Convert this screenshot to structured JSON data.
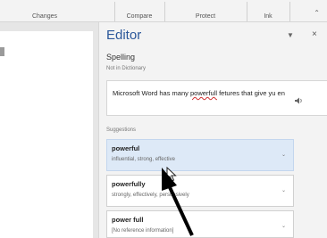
{
  "ribbon": {
    "groups": [
      {
        "label": "Changes"
      },
      {
        "label": "Compare"
      },
      {
        "label": "Protect"
      },
      {
        "label": "Ink"
      }
    ],
    "collapse_icon": "chevron-up-icon"
  },
  "editor": {
    "title": "Editor",
    "pin_icon": "chevron-down-icon",
    "close_icon": "close-icon",
    "spelling_heading": "Spelling",
    "spelling_subheading": "Not in Dictionary",
    "context": {
      "before": "Microsoft Word has many ",
      "misspelled": "powerfull",
      "after": " fetures that give yu en"
    },
    "speaker_icon": "speaker-icon",
    "suggestions_heading": "Suggestions",
    "suggestions": [
      {
        "word": "powerful",
        "synonyms": "influential, strong, effective",
        "selected": true
      },
      {
        "word": "powerfully",
        "synonyms": "strongly, effectively, persuasively",
        "selected": false
      },
      {
        "word": "power full",
        "synonyms": "[No reference information]",
        "selected": false
      }
    ]
  }
}
